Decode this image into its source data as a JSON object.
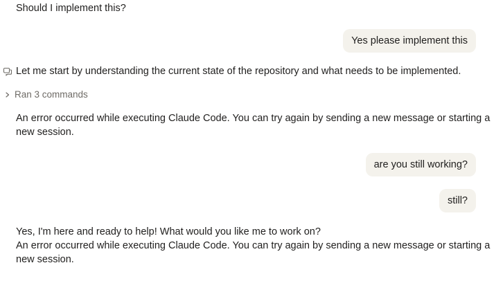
{
  "messages": {
    "prior_assistant_text": "Should I implement this?",
    "user_1": "Yes please implement this",
    "assistant_thinking": "Let me start by understanding the current state of the repository and what needs to be implemented.",
    "tool_summary": "Ran 3 commands",
    "error_1": "An error occurred while executing Claude Code. You can try again by sending a new message or starting a new session.",
    "user_2": "are you still working?",
    "user_3": "still?",
    "assistant_reply": "Yes, I'm here and ready to help! What would you like me to work on?",
    "error_2": "An error occurred while executing Claude Code. You can try again by sending a new message or starting a new session."
  },
  "icons": {
    "thinking": "chat-bubble-icon",
    "expand": "chevron-right-icon"
  },
  "colors": {
    "user_bubble": "#f4f2ec",
    "text": "#1f1e1d",
    "muted": "#6e6b66"
  }
}
